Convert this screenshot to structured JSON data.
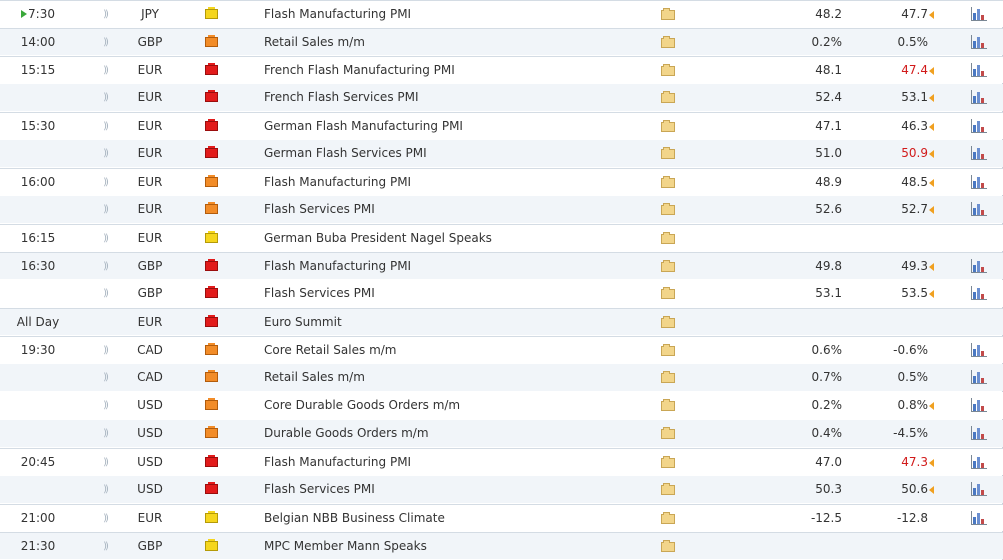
{
  "colors": {
    "high_impact": "#e21b1b",
    "medium_impact": "#f28c28",
    "low_impact": "#f5d61e",
    "worse_value": "#d11a1a",
    "arrow": "#f0a020",
    "now_marker": "#3aa83a"
  },
  "icons": {
    "sound": "sound-icon",
    "folder": "folder-icon",
    "chart": "chart-icon",
    "revision": "revision-arrow-icon"
  },
  "events": [
    {
      "time": "7:30",
      "now": true,
      "currency": "JPY",
      "impact": "low",
      "event": "Flash Manufacturing PMI",
      "actual": "48.2",
      "forecast": "47.7",
      "forecast_red": false,
      "arrow": true,
      "chart": true,
      "sound": true
    },
    {
      "time": "14:00",
      "currency": "GBP",
      "impact": "med",
      "event": "Retail Sales m/m",
      "actual": "0.2%",
      "forecast": "0.5%",
      "forecast_red": false,
      "arrow": false,
      "chart": true,
      "sound": true
    },
    {
      "time": "15:15",
      "currency": "EUR",
      "impact": "high",
      "event": "French Flash Manufacturing PMI",
      "actual": "48.1",
      "forecast": "47.4",
      "forecast_red": true,
      "arrow": true,
      "chart": true,
      "sound": true
    },
    {
      "time": "",
      "currency": "EUR",
      "impact": "high",
      "event": "French Flash Services PMI",
      "actual": "52.4",
      "forecast": "53.1",
      "forecast_red": false,
      "arrow": true,
      "chart": true,
      "sound": true
    },
    {
      "time": "15:30",
      "currency": "EUR",
      "impact": "high",
      "event": "German Flash Manufacturing PMI",
      "actual": "47.1",
      "forecast": "46.3",
      "forecast_red": false,
      "arrow": true,
      "chart": true,
      "sound": true
    },
    {
      "time": "",
      "currency": "EUR",
      "impact": "high",
      "event": "German Flash Services PMI",
      "actual": "51.0",
      "forecast": "50.9",
      "forecast_red": true,
      "arrow": true,
      "chart": true,
      "sound": true
    },
    {
      "time": "16:00",
      "currency": "EUR",
      "impact": "med",
      "event": "Flash Manufacturing PMI",
      "actual": "48.9",
      "forecast": "48.5",
      "forecast_red": false,
      "arrow": true,
      "chart": true,
      "sound": true
    },
    {
      "time": "",
      "currency": "EUR",
      "impact": "med",
      "event": "Flash Services PMI",
      "actual": "52.6",
      "forecast": "52.7",
      "forecast_red": false,
      "arrow": true,
      "chart": true,
      "sound": true
    },
    {
      "time": "16:15",
      "currency": "EUR",
      "impact": "low",
      "event": "German Buba President Nagel Speaks",
      "actual": "",
      "forecast": "",
      "forecast_red": false,
      "arrow": false,
      "chart": false,
      "sound": true
    },
    {
      "time": "16:30",
      "currency": "GBP",
      "impact": "high",
      "event": "Flash Manufacturing PMI",
      "actual": "49.8",
      "forecast": "49.3",
      "forecast_red": false,
      "arrow": true,
      "chart": true,
      "sound": true
    },
    {
      "time": "",
      "currency": "GBP",
      "impact": "high",
      "event": "Flash Services PMI",
      "actual": "53.1",
      "forecast": "53.5",
      "forecast_red": false,
      "arrow": true,
      "chart": true,
      "sound": true
    },
    {
      "time": "All Day",
      "currency": "EUR",
      "impact": "high",
      "event": "Euro Summit",
      "actual": "",
      "forecast": "",
      "forecast_red": false,
      "arrow": false,
      "chart": false,
      "sound": false
    },
    {
      "time": "19:30",
      "currency": "CAD",
      "impact": "med",
      "event": "Core Retail Sales m/m",
      "actual": "0.6%",
      "forecast": "-0.6%",
      "forecast_red": false,
      "arrow": false,
      "chart": true,
      "sound": true
    },
    {
      "time": "",
      "currency": "CAD",
      "impact": "med",
      "event": "Retail Sales m/m",
      "actual": "0.7%",
      "forecast": "0.5%",
      "forecast_red": false,
      "arrow": false,
      "chart": true,
      "sound": true
    },
    {
      "time": "",
      "currency": "USD",
      "impact": "med",
      "event": "Core Durable Goods Orders m/m",
      "actual": "0.2%",
      "forecast": "0.8%",
      "forecast_red": false,
      "arrow": true,
      "chart": true,
      "sound": true
    },
    {
      "time": "",
      "currency": "USD",
      "impact": "med",
      "event": "Durable Goods Orders m/m",
      "actual": "0.4%",
      "forecast": "-4.5%",
      "forecast_red": false,
      "arrow": false,
      "chart": true,
      "sound": true
    },
    {
      "time": "20:45",
      "currency": "USD",
      "impact": "high",
      "event": "Flash Manufacturing PMI",
      "actual": "47.0",
      "forecast": "47.3",
      "forecast_red": true,
      "arrow": true,
      "chart": true,
      "sound": true
    },
    {
      "time": "",
      "currency": "USD",
      "impact": "high",
      "event": "Flash Services PMI",
      "actual": "50.3",
      "forecast": "50.6",
      "forecast_red": false,
      "arrow": true,
      "chart": true,
      "sound": true
    },
    {
      "time": "21:00",
      "currency": "EUR",
      "impact": "low",
      "event": "Belgian NBB Business Climate",
      "actual": "-12.5",
      "forecast": "-12.8",
      "forecast_red": false,
      "arrow": false,
      "chart": true,
      "sound": true
    },
    {
      "time": "21:30",
      "currency": "GBP",
      "impact": "low",
      "event": "MPC Member Mann Speaks",
      "actual": "",
      "forecast": "",
      "forecast_red": false,
      "arrow": false,
      "chart": false,
      "sound": true
    }
  ]
}
